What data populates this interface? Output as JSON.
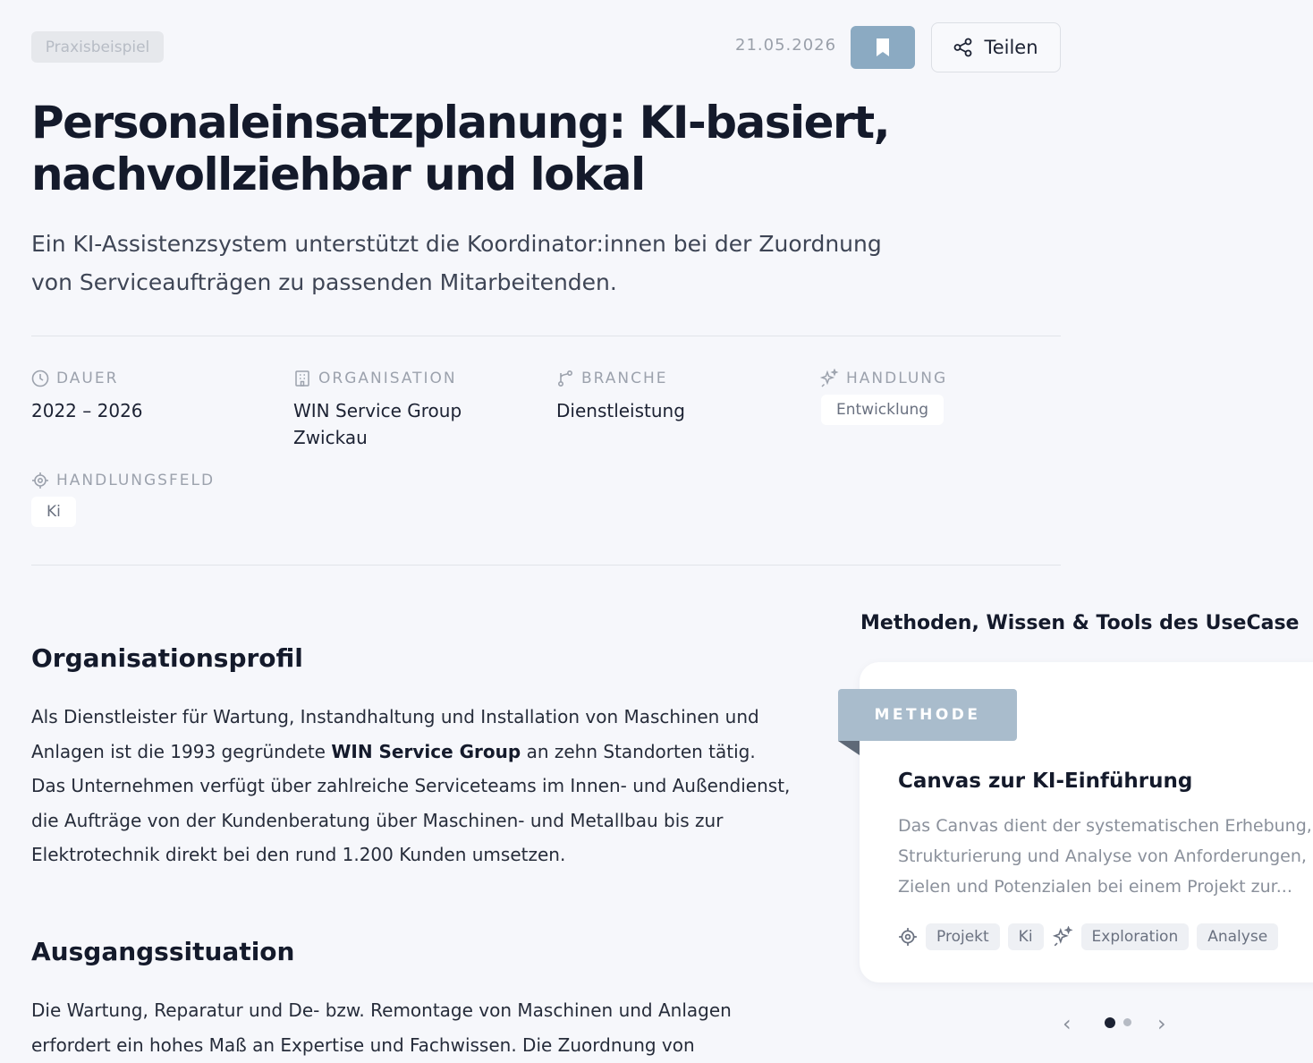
{
  "header": {
    "category_tag": "Praxisbeispiel",
    "date": "21.05.2026",
    "share_label": "Teilen"
  },
  "article": {
    "title": "Personaleinsatzplanung: KI-basiert, nachvollziehbar und lokal",
    "lead": "Ein KI-Assistenzsystem unterstützt die Koordinator:innen bei der Zuordnung von Serviceaufträgen zu passenden Mitarbeitenden."
  },
  "meta": {
    "dauer": {
      "label": "DAUER",
      "value": "2022 – 2026",
      "icon": "clock-icon"
    },
    "organisation": {
      "label": "ORGANISATION",
      "value": "WIN Service Group Zwickau",
      "icon": "building-icon"
    },
    "branche": {
      "label": "BRANCHE",
      "value": "Dienstleistung",
      "icon": "branch-icon"
    },
    "handlung": {
      "label": "HANDLUNG",
      "value": "Entwicklung",
      "icon": "sparkle-icon"
    },
    "handlungsfeld": {
      "label": "HANDLUNGSFELD",
      "value": "Ki",
      "icon": "target-icon"
    }
  },
  "sections": {
    "profil": {
      "heading": "Organisationsprofil",
      "text_before": "Als Dienstleister für Wartung, Instandhaltung und Installation von Maschinen und Anlagen ist die 1993 gegründete ",
      "text_bold": "WIN Service Group",
      "text_after": " an zehn Standorten tätig. Das Unternehmen verfügt über zahlreiche Serviceteams im Innen- und Außendienst, die Aufträge von der Kundenberatung über Maschinen- und Metallbau bis zur Elektrotechnik direkt bei den rund 1.200 Kunden umsetzen."
    },
    "ausgang": {
      "heading": "Ausgangssituation",
      "text": "Die Wartung, Reparatur und De- bzw. Remontage von Maschinen und Anlagen erfordert ein hohes Maß an Expertise und Fachwissen. Die Zuordnung von"
    }
  },
  "sidebar": {
    "title": "Methoden, Wissen & Tools des UseCase",
    "card": {
      "ribbon": "METHODE",
      "title": "Canvas zur KI-Einführung",
      "description_lines": [
        "Das Canvas dient der systematischen Erhebung,",
        "Strukturierung und Analyse von Anforderungen,",
        "Zielen und Potenzialen bei einem Projekt zur..."
      ],
      "tags_group1": [
        "Projekt",
        "Ki"
      ],
      "tags_group2": [
        "Exploration",
        "Analyse"
      ]
    },
    "carousel": {
      "prev": "‹",
      "next": "›",
      "pages": 2,
      "active_page": 1
    }
  },
  "colors": {
    "background": "#f6f7fb",
    "bookmark_button": "#8baac2",
    "ribbon": "#a9bccc",
    "title_text": "#141a2b"
  }
}
